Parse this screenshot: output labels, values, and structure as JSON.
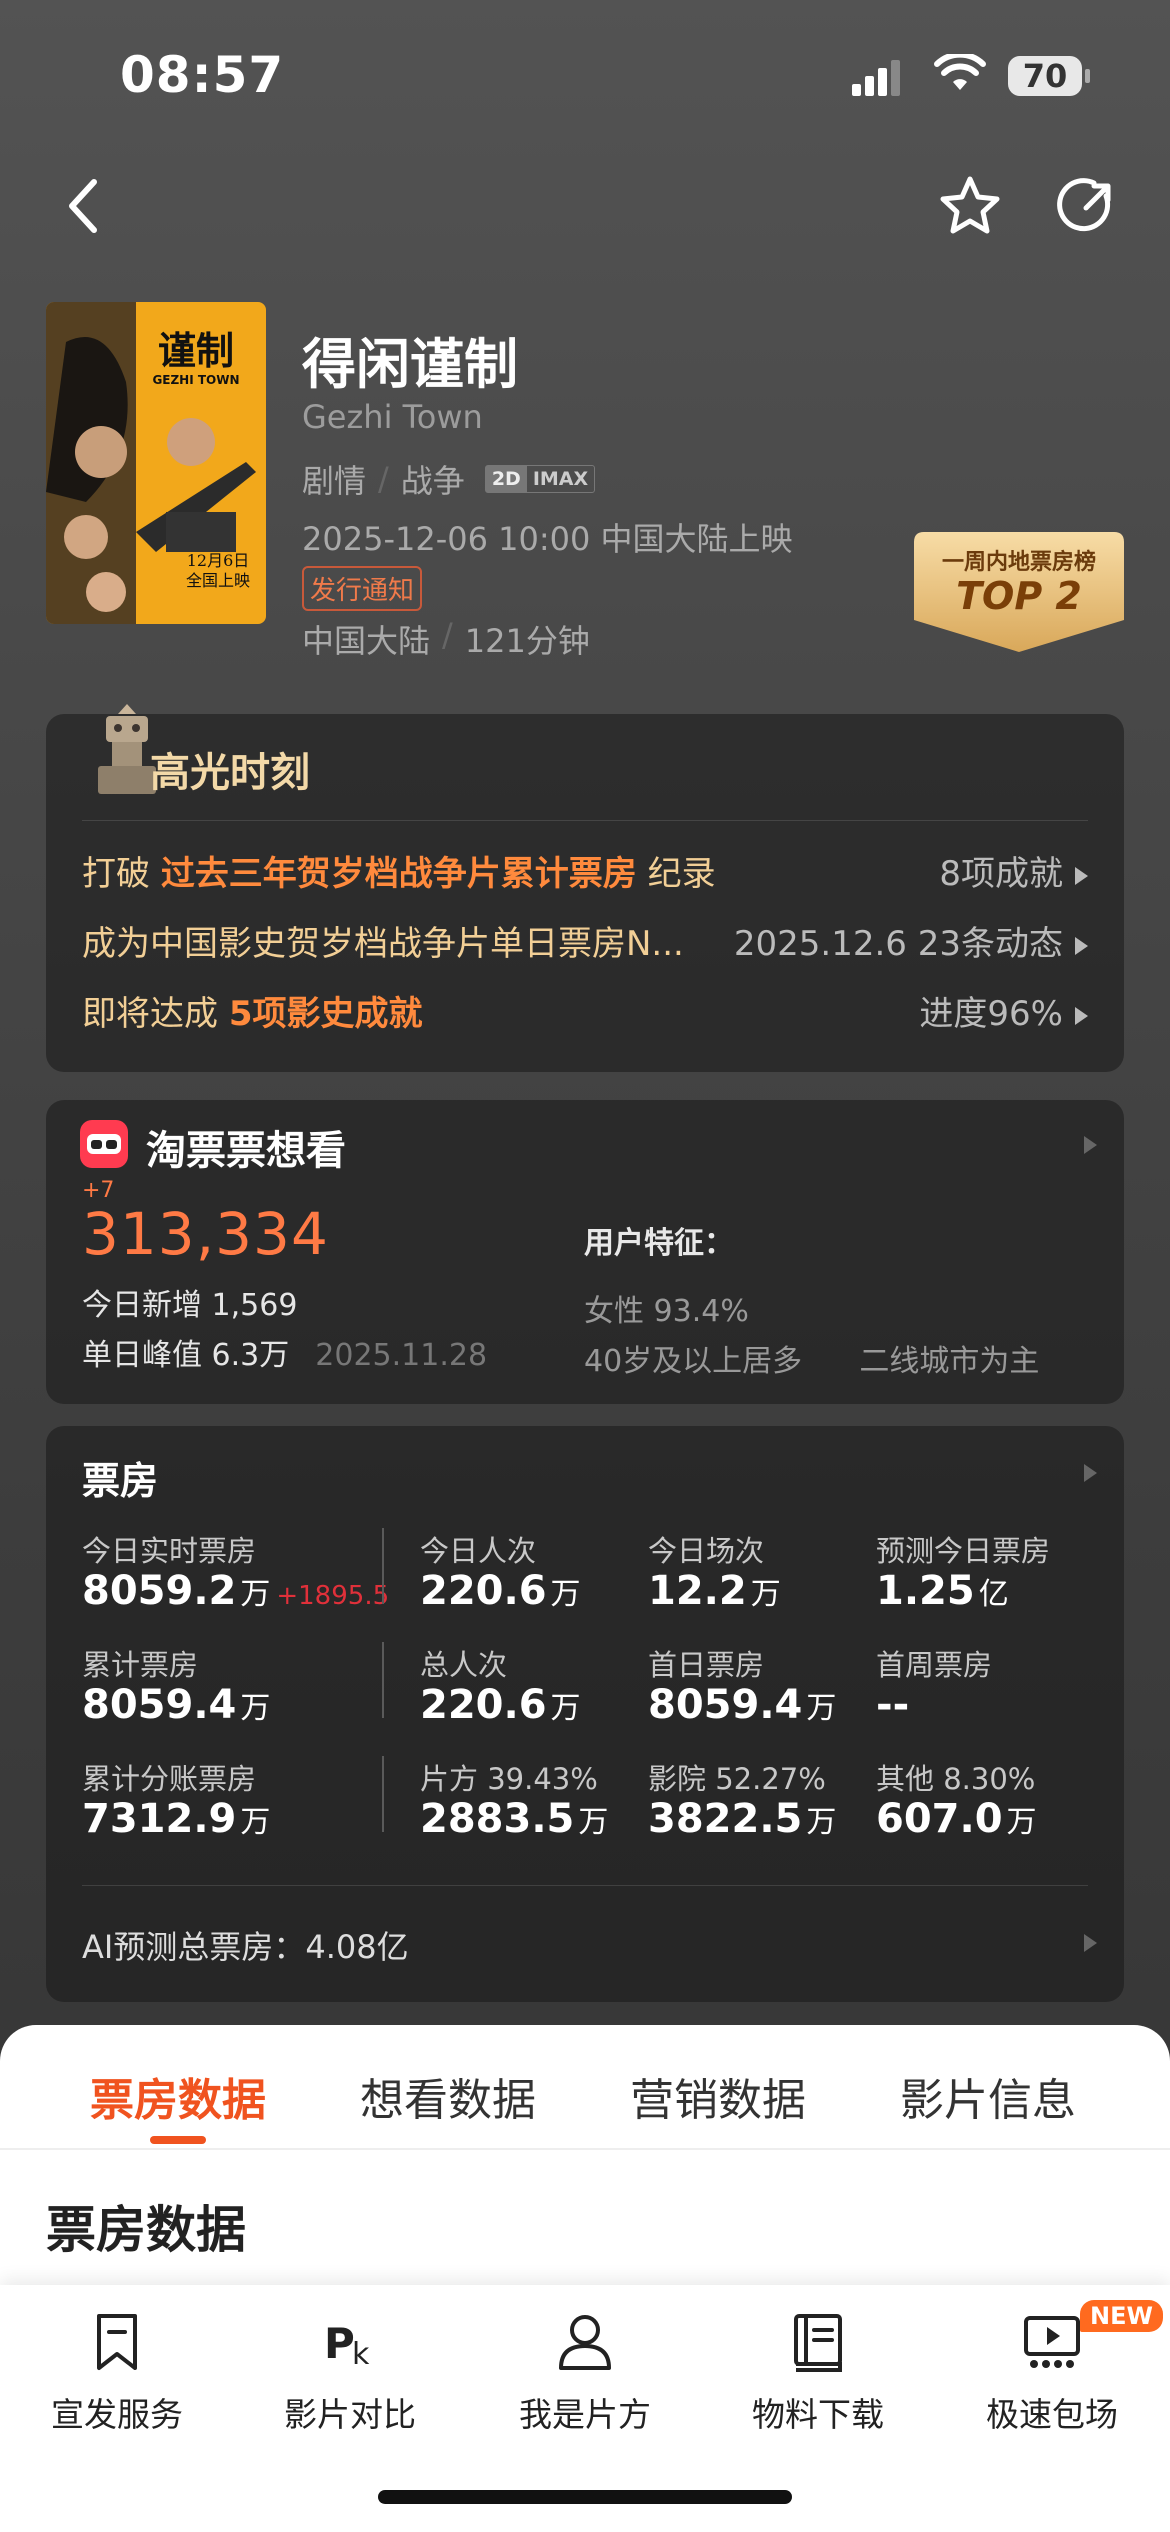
{
  "status": {
    "time": "08:57",
    "battery": "70"
  },
  "movie": {
    "title": "得闲谨制",
    "en_title": "Gezhi Town",
    "genres": [
      "剧情",
      "战争"
    ],
    "formats": [
      "2D",
      "IMAX"
    ],
    "release": "2025-12-06 10:00 中国大陆上映",
    "tag": "发行通知",
    "region": "中国大陆",
    "duration": "121分钟",
    "poster_text": {
      "title": "谨制",
      "en": "GEZHI TOWN",
      "date": "12月6日",
      "date2": "全国上映"
    }
  },
  "rank_badge": {
    "label": "一周内地票房榜",
    "rank": "TOP 2"
  },
  "highlights": {
    "title": "高光时刻",
    "rows": [
      {
        "pre": "打破 ",
        "em": "过去三年贺岁档战争片累计票房",
        "post": " 纪录",
        "right": "8项成就"
      },
      {
        "pre": "成为中国影史贺岁档战争片单日票房N...",
        "em": "",
        "post": "",
        "right": "2025.12.6  23条动态"
      },
      {
        "pre": "即将达成 ",
        "em": "5项影史成就",
        "post": "",
        "right": "进度96%"
      }
    ]
  },
  "wants": {
    "title": "淘票票想看",
    "increment": "+7",
    "total": "313,334",
    "today_label": "今日新增",
    "today_value": "1,569",
    "peak_label": "单日峰值",
    "peak_value": "6.3万",
    "peak_date": "2025.11.28",
    "user_title": "用户特征：",
    "female": "女性 93.4%",
    "traits": "40岁及以上居多      二线城市为主"
  },
  "boxoffice": {
    "title": "票房",
    "r1": [
      {
        "label": "今日实时票房",
        "value": "8059.2",
        "unit": "万",
        "delta": "+1895.5"
      },
      {
        "label": "今日人次",
        "value": "220.6",
        "unit": "万"
      },
      {
        "label": "今日场次",
        "value": "12.2",
        "unit": "万"
      },
      {
        "label": "预测今日票房",
        "value": "1.25",
        "unit": "亿"
      }
    ],
    "r2": [
      {
        "label": "累计票房",
        "value": "8059.4",
        "unit": "万"
      },
      {
        "label": "总人次",
        "value": "220.6",
        "unit": "万"
      },
      {
        "label": "首日票房",
        "value": "8059.4",
        "unit": "万"
      },
      {
        "label": "首周票房",
        "value": "--",
        "unit": ""
      }
    ],
    "r3": [
      {
        "label": "累计分账票房",
        "value": "7312.9",
        "unit": "万"
      },
      {
        "label": "片方 39.43%",
        "value": "2883.5",
        "unit": "万"
      },
      {
        "label": "影院 52.27%",
        "value": "3822.5",
        "unit": "万"
      },
      {
        "label": "其他 8.30%",
        "value": "607.0",
        "unit": "万"
      }
    ],
    "ai": "AI预测总票房：4.08亿"
  },
  "tabs": [
    "票房数据",
    "想看数据",
    "营销数据",
    "影片信息"
  ],
  "section_title": "票房数据",
  "toolbar": [
    "宣发服务",
    "影片对比",
    "我是片方",
    "物料下载",
    "极速包场"
  ],
  "new_badge": "NEW"
}
